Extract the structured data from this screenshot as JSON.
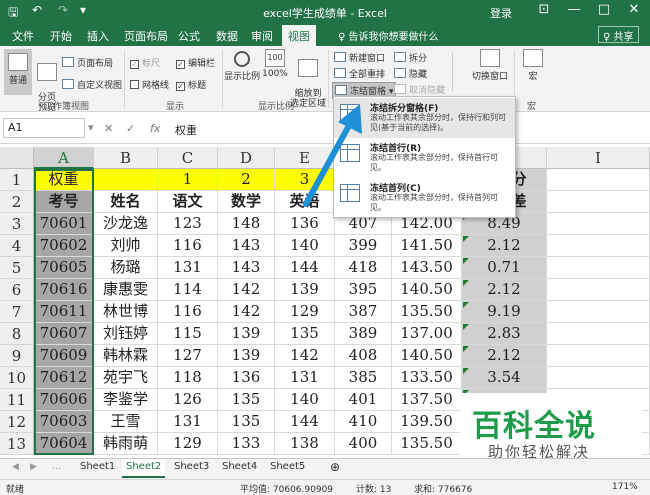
{
  "window": {
    "title": "excel学生成绩单 - Excel",
    "login": "登录",
    "minimize": "—",
    "restore": "□",
    "close": "✕",
    "restore_ribbon": "⊡"
  },
  "quick_access": {
    "save": "🖫",
    "undo": "↶",
    "redo": "↷",
    "more": "▾"
  },
  "menu": {
    "tabs": [
      "文件",
      "开始",
      "插入",
      "页面布局",
      "公式",
      "数据",
      "审阅",
      "视图"
    ],
    "active": "视图",
    "tell_me": "♀ 告诉我你想要做什么",
    "share": "♀ 共享"
  },
  "ribbon": {
    "normal": "普通",
    "page_break": "分页\n预览",
    "page_layout": "页面布局",
    "custom_views": "自定义视图",
    "group_views": "工作簿视图",
    "ruler": "标尺",
    "formula_bar": "编辑栏",
    "gridlines": "网格线",
    "headings": "标题",
    "group_show": "显示",
    "zoom": "显示比例",
    "zoom100": "100%",
    "zoom_sel": "缩放到\n选定区域",
    "group_zoom": "显示比例",
    "new_window": "新建窗口",
    "arrange_all": "全部重排",
    "freeze": "冻结窗格 ▾",
    "split": "拆分",
    "hide": "隐藏",
    "unhide": "取消隐藏",
    "switch_windows": "切换窗口",
    "macros": "宏",
    "group_macro": "宏",
    "check_mark": "✓"
  },
  "formula": {
    "namebox": "A1",
    "cancel": "✕",
    "enter": "✓",
    "fx": "fx",
    "content": "权重"
  },
  "columns": [
    "A",
    "B",
    "C",
    "D",
    "E",
    "F",
    "G",
    "H",
    "I"
  ],
  "rows": [
    "1",
    "2",
    "3",
    "4",
    "5",
    "6",
    "7",
    "8",
    "9",
    "10",
    "11",
    "12",
    "13"
  ],
  "row1": {
    "a": "权重",
    "c": "1",
    "d": "2",
    "e": "3"
  },
  "row2": {
    "a": "考号",
    "b": "姓名",
    "c": "语文",
    "d": "数学",
    "e": "英语",
    "h": "总学分",
    "h2": "标准差"
  },
  "data": [
    [
      "70601",
      "沙龙逸",
      "123",
      "148",
      "136",
      "407",
      "142.00",
      "8.49"
    ],
    [
      "70602",
      "刘帅",
      "116",
      "143",
      "140",
      "399",
      "141.50",
      "2.12"
    ],
    [
      "70605",
      "杨璐",
      "131",
      "143",
      "144",
      "418",
      "143.50",
      "0.71"
    ],
    [
      "70616",
      "康惠雯",
      "114",
      "142",
      "139",
      "395",
      "140.50",
      "2.12"
    ],
    [
      "70611",
      "林世博",
      "116",
      "142",
      "129",
      "387",
      "135.50",
      "9.19"
    ],
    [
      "70607",
      "刘钰婷",
      "115",
      "139",
      "135",
      "389",
      "137.00",
      "2.83"
    ],
    [
      "70609",
      "韩林霖",
      "127",
      "139",
      "142",
      "408",
      "140.50",
      "2.12"
    ],
    [
      "70612",
      "苑宇飞",
      "118",
      "136",
      "131",
      "385",
      "133.50",
      "3.54"
    ],
    [
      "70606",
      "李鉴学",
      "126",
      "135",
      "140",
      "401",
      "137.50",
      ""
    ],
    [
      "70603",
      "王雪",
      "131",
      "135",
      "144",
      "410",
      "139.50",
      ""
    ],
    [
      "70604",
      "韩雨萌",
      "129",
      "133",
      "138",
      "400",
      "135.50",
      ""
    ]
  ],
  "dropdown": {
    "items": [
      {
        "title": "冻结拆分窗格(F)",
        "desc": "滚动工作表其余部分时，保持行和列可见(基于当前的选择)。"
      },
      {
        "title": "冻结首行(R)",
        "desc": "滚动工作表其余部分时，保持首行可见。"
      },
      {
        "title": "冻结首列(C)",
        "desc": "滚动工作表其余部分时，保持首列可见。"
      }
    ]
  },
  "sheets": [
    "Sheet1",
    "Sheet2",
    "Sheet3",
    "Sheet4",
    "Sheet5"
  ],
  "active_sheet": "Sheet2",
  "add_sheet": "⊕",
  "status": {
    "ready": "就绪",
    "average": "平均值: 70606.90909",
    "count": "计数: 13",
    "sum": "求和: 776676",
    "zoom": "171%"
  },
  "watermark": {
    "line1": "百科全说",
    "line2": "助你轻松解决"
  },
  "colors": {
    "excel_green": "#217346",
    "highlight_yellow": "#ffff00",
    "arrow_blue": "#1e90d6"
  }
}
